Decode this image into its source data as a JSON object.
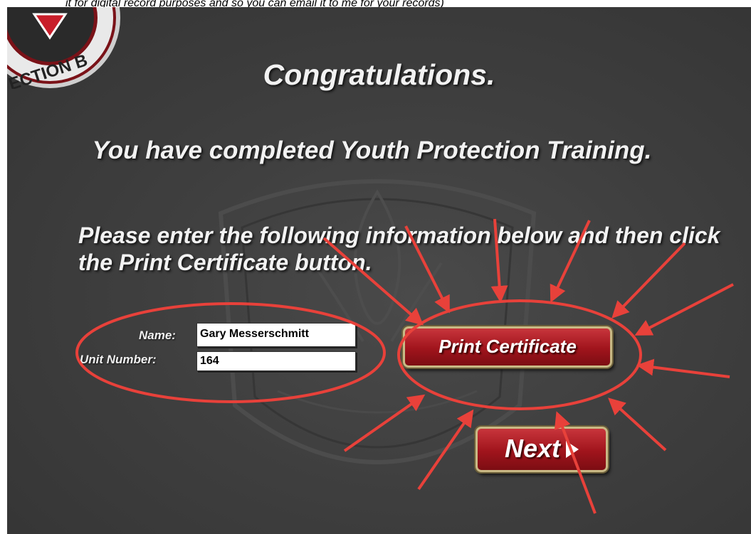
{
  "caption": "it for digital record purposes and so you can email it to me for your records)",
  "seal": {
    "text": "ECTION B"
  },
  "headings": {
    "congrats": "Congratulations.",
    "completed": "You have completed Youth Protection Training."
  },
  "instructions": "Please enter the following information below and then click the Print Certificate button.",
  "form": {
    "name_label": "Name:",
    "name_value": "Gary Messerschmitt",
    "unit_label": "Unit Number:",
    "unit_value": "164"
  },
  "buttons": {
    "print": "Print Certificate",
    "next": "Next"
  },
  "colors": {
    "background": "#3f3f3f",
    "annotation": "#e8413a",
    "button": "#a0141c",
    "button_border": "#c9b985"
  }
}
